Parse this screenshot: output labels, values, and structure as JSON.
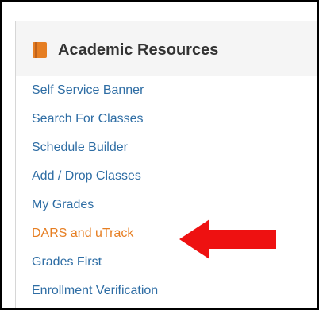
{
  "panel": {
    "title": "Academic Resources",
    "icon": "book-icon",
    "accent_color": "#e67e22"
  },
  "links": [
    {
      "label": "Self Service Banner"
    },
    {
      "label": "Search For Classes"
    },
    {
      "label": "Schedule Builder"
    },
    {
      "label": "Add / Drop Classes"
    },
    {
      "label": "My Grades"
    },
    {
      "label": "DARS and uTrack",
      "active": true
    },
    {
      "label": "Grades First"
    },
    {
      "label": "Enrollment Verification"
    }
  ],
  "annotation": {
    "icon": "red-arrow-icon",
    "color": "#ee1111"
  }
}
